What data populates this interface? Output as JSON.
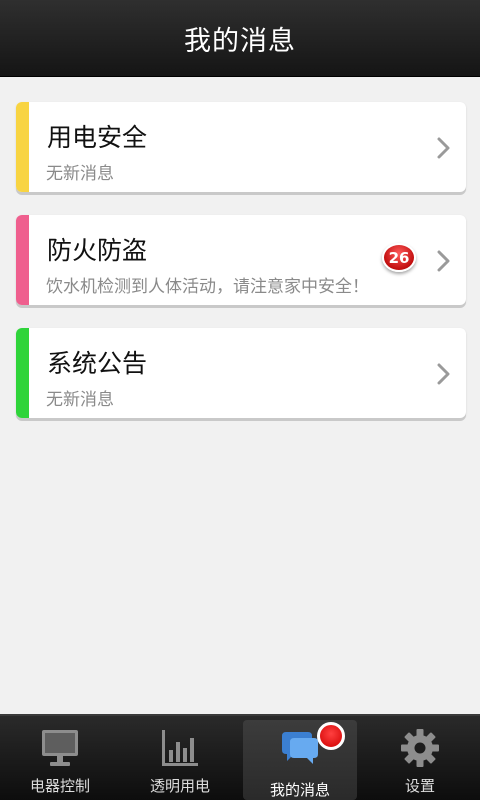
{
  "header": {
    "title": "我的消息"
  },
  "messages": [
    {
      "title": "用电安全",
      "subtitle": "无新消息",
      "accent": "#f8d442"
    },
    {
      "title": "防火防盗",
      "subtitle": "饮水机检测到人体活动，请注意家中安全！",
      "accent": "#ef5f8e",
      "badge": "26"
    },
    {
      "title": "系统公告",
      "subtitle": "无新消息",
      "accent": "#2fd43a"
    }
  ],
  "tabs": [
    {
      "label": "电器控制",
      "icon": "monitor-icon"
    },
    {
      "label": "透明用电",
      "icon": "bar-chart-icon"
    },
    {
      "label": "我的消息",
      "icon": "chat-bubble-icon",
      "active": true
    },
    {
      "label": "设置",
      "icon": "gear-icon"
    }
  ],
  "colors": {
    "title_bar": "#1c1c1c",
    "background": "#f1f1f1",
    "badge": "#d01010",
    "tab_bar": "#161616"
  }
}
